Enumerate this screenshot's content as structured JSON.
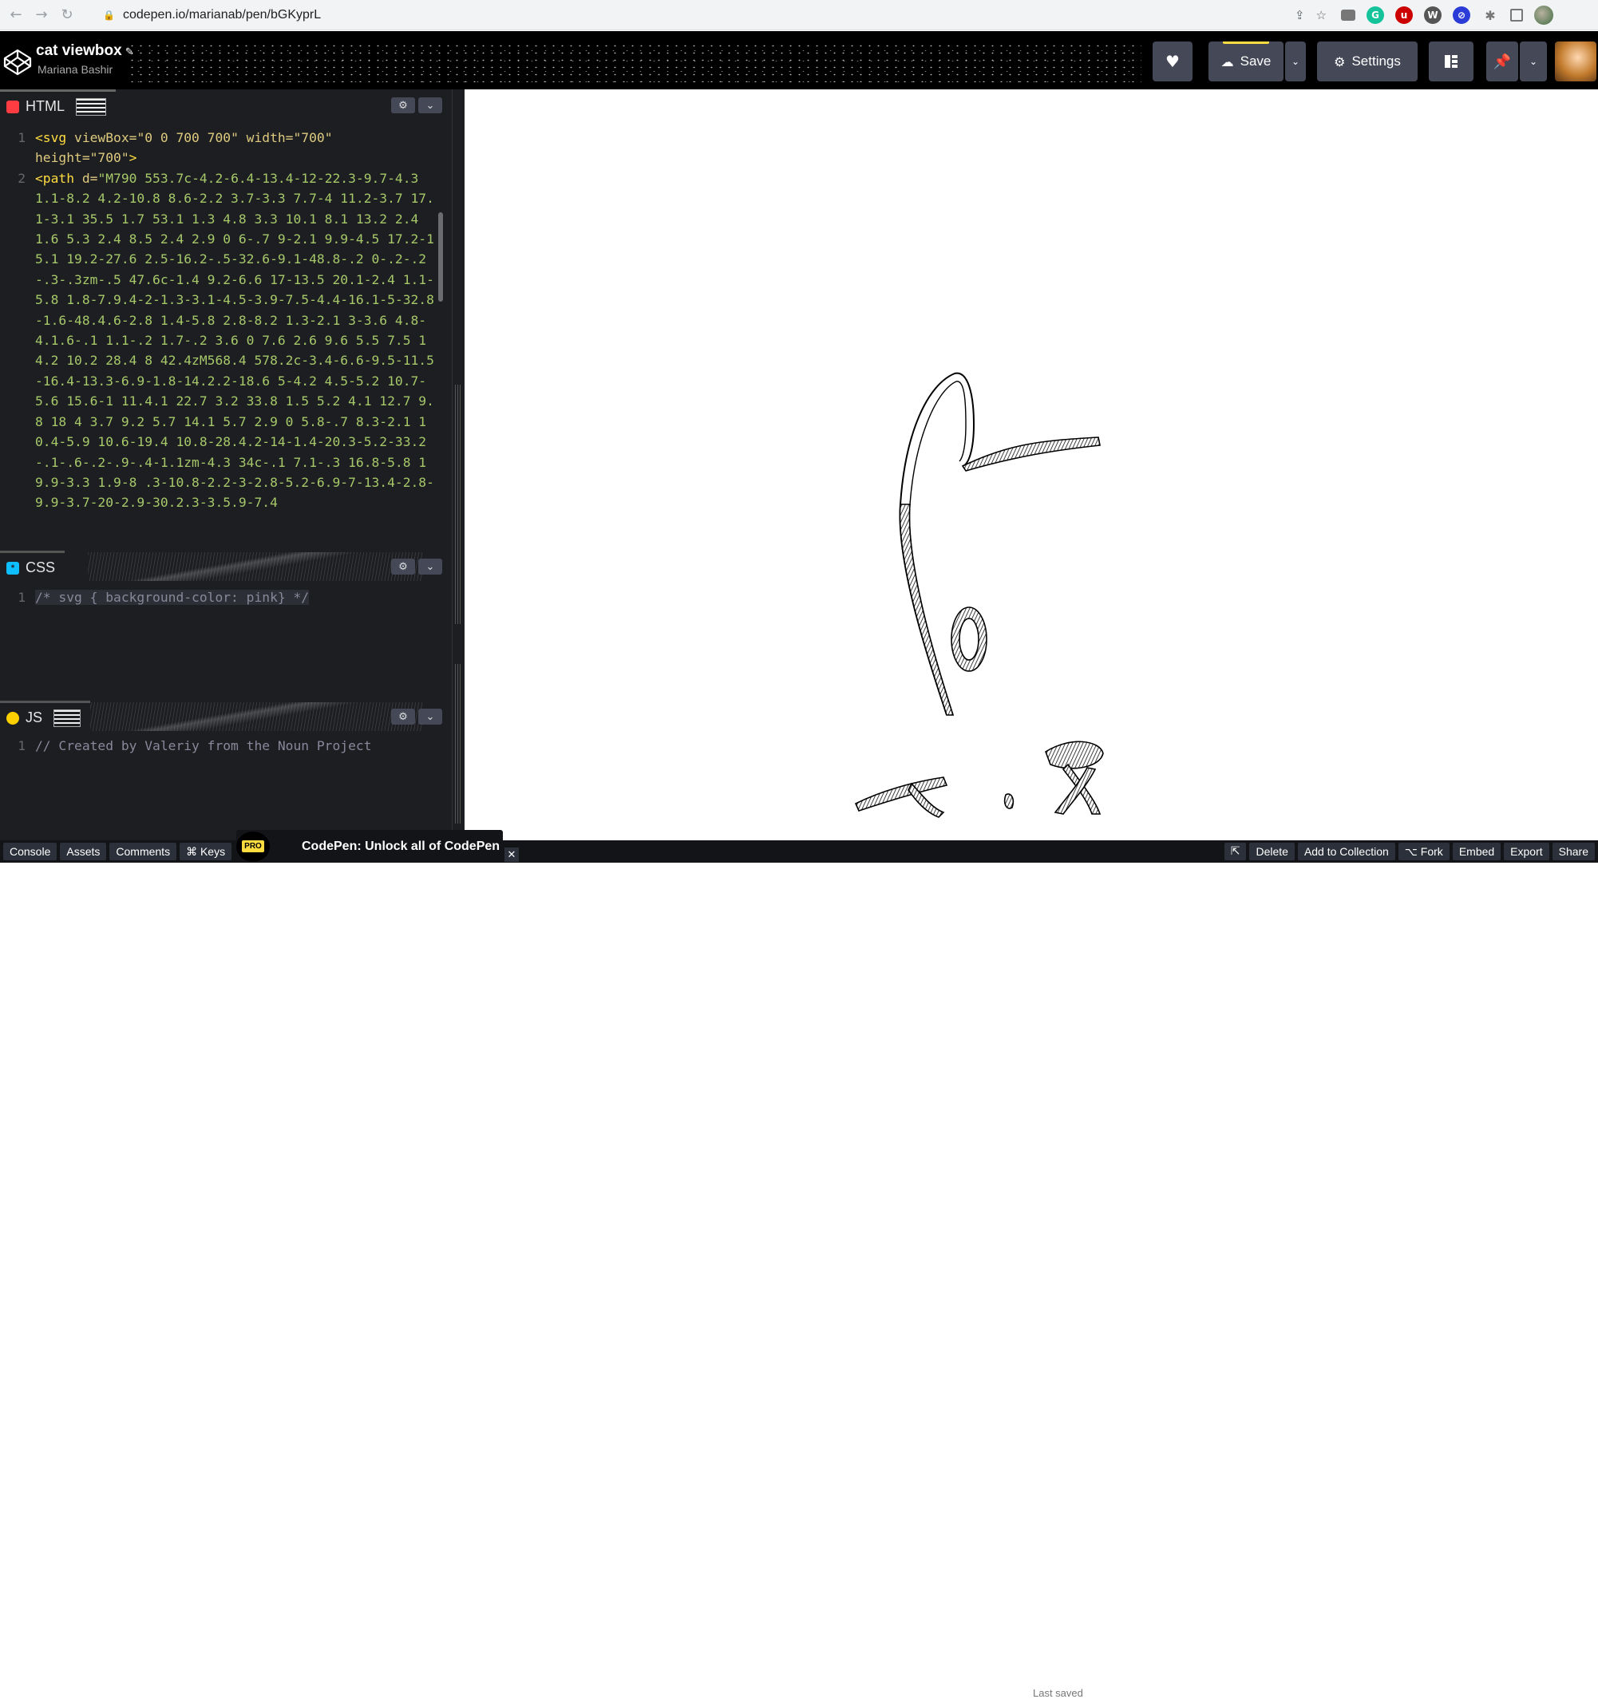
{
  "browser": {
    "url": "codepen.io/marianab/pen/bGKyprL",
    "nav": {
      "back": "←",
      "forward": "→",
      "reload": "↻"
    },
    "icons": [
      "lock-icon",
      "share-icon",
      "star-icon",
      "camera-icon",
      "grammarly-icon",
      "ublock-icon",
      "wordpress-icon",
      "extension-blue-icon",
      "puzzle-icon",
      "sidebar-icon",
      "profile-avatar"
    ]
  },
  "header": {
    "pen_title": "cat viewbox",
    "pen_author": "Mariana Bashir",
    "save_label": "Save",
    "settings_label": "Settings",
    "accent_color": "#ffdd40"
  },
  "panes": {
    "html": {
      "label": "HTML",
      "badge_color": "#ff3c41",
      "line_numbers": [
        "1",
        "2"
      ],
      "line1_tag": "<svg",
      "line1_attrs": " viewBox=\"0 0 700 700\" width=\"700\"\nheight=\"700\"",
      "line1_close": ">",
      "line2_tag": "<path",
      "line2_attr": " d=",
      "line2_value": "\"M790 553.7c-4.2-6.4-13.4-12-22.3-9.7-4.3 1.1-8.2 4.2-10.8 8.6-2.2 3.7-3.3 7.7-4 11.2-3.7 17.1-3.1 35.5 1.7 53.1 1.3 4.8 3.3 10.1 8.1 13.2 2.4 1.6 5.3 2.4 8.5 2.4 2.9 0 6-.7 9-2.1 9.9-4.5 17.2-15.1 19.2-27.6 2.5-16.2-.5-32.6-9.1-48.8-.2 0-.2-.2-.3-.3zm-.5 47.6c-1.4 9.2-6.6 17-13.5 20.1-2.4 1.1-5.8 1.8-7.9.4-2-1.3-3.1-4.5-3.9-7.5-4.4-16.1-5-32.8-1.6-48.4.6-2.8 1.4-5.8 2.8-8.2 1.3-2.1 3-3.6 4.8-4.1.6-.1 1.1-.2 1.7-.2 3.6 0 7.6 2.6 9.6 5.5 7.5 14.2 10.2 28.4 8 42.4zM568.4 578.2c-3.4-6.6-9.5-11.5-16.4-13.3-6.9-1.8-14.2.2-18.6 5-4.2 4.5-5.2 10.7-5.6 15.6-1 11.4.1 22.7 3.2 33.8 1.5 5.2 4.1 12.7 9.8 18 4 3.7 9.2 5.7 14.1 5.7 2.9 0 5.8-.7 8.3-2.1 10.4-5.9 10.6-19.4 10.8-28.4.2-14-1.4-20.3-5.2-33.2-.1-.6-.2-.9-.4-1.1zm-4.3 34c-.1 7.1-.3 16.8-5.8 19.9-3.3 1.9-8 .3-10.8-2.2-3-2.8-5.2-6.9-7-13.4-2.8-9.9-3.7-20-2.9-30.2.3-3.5.9-7.4"
    },
    "css": {
      "label": "CSS",
      "badge_color": "#0ebeff",
      "line_numbers": [
        "1"
      ],
      "code": "/* svg { background-color: pink} */"
    },
    "js": {
      "label": "JS",
      "badge_color": "#fcd000",
      "line_numbers": [
        "1"
      ],
      "code": "// Created by Valeriy from the Noun Project"
    }
  },
  "footer": {
    "left_buttons": [
      "Console",
      "Assets",
      "Comments",
      "⌘ Keys"
    ],
    "promo_badge": "PRO",
    "promo_text": "CodePen: Unlock all of CodePen",
    "close": "✕",
    "last_saved": "Last saved",
    "right_buttons": [
      "Delete",
      "Add to Collection",
      "⌥ Fork",
      "Embed",
      "Export",
      "Share"
    ]
  }
}
